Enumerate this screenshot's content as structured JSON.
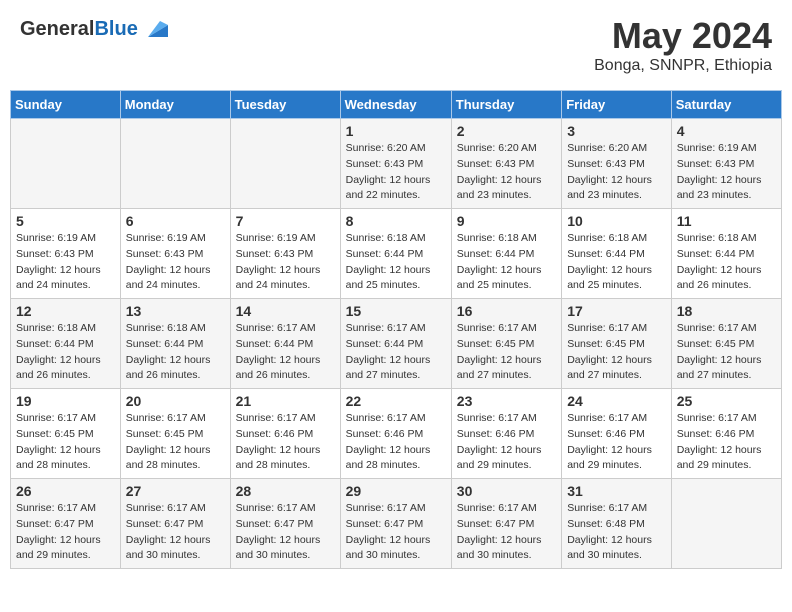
{
  "header": {
    "logo_general": "General",
    "logo_blue": "Blue",
    "main_title": "May 2024",
    "subtitle": "Bonga, SNNPR, Ethiopia"
  },
  "days_of_week": [
    "Sunday",
    "Monday",
    "Tuesday",
    "Wednesday",
    "Thursday",
    "Friday",
    "Saturday"
  ],
  "weeks": [
    {
      "days": [
        {
          "num": "",
          "sunrise": "",
          "sunset": "",
          "daylight": ""
        },
        {
          "num": "",
          "sunrise": "",
          "sunset": "",
          "daylight": ""
        },
        {
          "num": "",
          "sunrise": "",
          "sunset": "",
          "daylight": ""
        },
        {
          "num": "1",
          "sunrise": "Sunrise: 6:20 AM",
          "sunset": "Sunset: 6:43 PM",
          "daylight": "Daylight: 12 hours and 22 minutes."
        },
        {
          "num": "2",
          "sunrise": "Sunrise: 6:20 AM",
          "sunset": "Sunset: 6:43 PM",
          "daylight": "Daylight: 12 hours and 23 minutes."
        },
        {
          "num": "3",
          "sunrise": "Sunrise: 6:20 AM",
          "sunset": "Sunset: 6:43 PM",
          "daylight": "Daylight: 12 hours and 23 minutes."
        },
        {
          "num": "4",
          "sunrise": "Sunrise: 6:19 AM",
          "sunset": "Sunset: 6:43 PM",
          "daylight": "Daylight: 12 hours and 23 minutes."
        }
      ]
    },
    {
      "days": [
        {
          "num": "5",
          "sunrise": "Sunrise: 6:19 AM",
          "sunset": "Sunset: 6:43 PM",
          "daylight": "Daylight: 12 hours and 24 minutes."
        },
        {
          "num": "6",
          "sunrise": "Sunrise: 6:19 AM",
          "sunset": "Sunset: 6:43 PM",
          "daylight": "Daylight: 12 hours and 24 minutes."
        },
        {
          "num": "7",
          "sunrise": "Sunrise: 6:19 AM",
          "sunset": "Sunset: 6:43 PM",
          "daylight": "Daylight: 12 hours and 24 minutes."
        },
        {
          "num": "8",
          "sunrise": "Sunrise: 6:18 AM",
          "sunset": "Sunset: 6:44 PM",
          "daylight": "Daylight: 12 hours and 25 minutes."
        },
        {
          "num": "9",
          "sunrise": "Sunrise: 6:18 AM",
          "sunset": "Sunset: 6:44 PM",
          "daylight": "Daylight: 12 hours and 25 minutes."
        },
        {
          "num": "10",
          "sunrise": "Sunrise: 6:18 AM",
          "sunset": "Sunset: 6:44 PM",
          "daylight": "Daylight: 12 hours and 25 minutes."
        },
        {
          "num": "11",
          "sunrise": "Sunrise: 6:18 AM",
          "sunset": "Sunset: 6:44 PM",
          "daylight": "Daylight: 12 hours and 26 minutes."
        }
      ]
    },
    {
      "days": [
        {
          "num": "12",
          "sunrise": "Sunrise: 6:18 AM",
          "sunset": "Sunset: 6:44 PM",
          "daylight": "Daylight: 12 hours and 26 minutes."
        },
        {
          "num": "13",
          "sunrise": "Sunrise: 6:18 AM",
          "sunset": "Sunset: 6:44 PM",
          "daylight": "Daylight: 12 hours and 26 minutes."
        },
        {
          "num": "14",
          "sunrise": "Sunrise: 6:17 AM",
          "sunset": "Sunset: 6:44 PM",
          "daylight": "Daylight: 12 hours and 26 minutes."
        },
        {
          "num": "15",
          "sunrise": "Sunrise: 6:17 AM",
          "sunset": "Sunset: 6:44 PM",
          "daylight": "Daylight: 12 hours and 27 minutes."
        },
        {
          "num": "16",
          "sunrise": "Sunrise: 6:17 AM",
          "sunset": "Sunset: 6:45 PM",
          "daylight": "Daylight: 12 hours and 27 minutes."
        },
        {
          "num": "17",
          "sunrise": "Sunrise: 6:17 AM",
          "sunset": "Sunset: 6:45 PM",
          "daylight": "Daylight: 12 hours and 27 minutes."
        },
        {
          "num": "18",
          "sunrise": "Sunrise: 6:17 AM",
          "sunset": "Sunset: 6:45 PM",
          "daylight": "Daylight: 12 hours and 27 minutes."
        }
      ]
    },
    {
      "days": [
        {
          "num": "19",
          "sunrise": "Sunrise: 6:17 AM",
          "sunset": "Sunset: 6:45 PM",
          "daylight": "Daylight: 12 hours and 28 minutes."
        },
        {
          "num": "20",
          "sunrise": "Sunrise: 6:17 AM",
          "sunset": "Sunset: 6:45 PM",
          "daylight": "Daylight: 12 hours and 28 minutes."
        },
        {
          "num": "21",
          "sunrise": "Sunrise: 6:17 AM",
          "sunset": "Sunset: 6:46 PM",
          "daylight": "Daylight: 12 hours and 28 minutes."
        },
        {
          "num": "22",
          "sunrise": "Sunrise: 6:17 AM",
          "sunset": "Sunset: 6:46 PM",
          "daylight": "Daylight: 12 hours and 28 minutes."
        },
        {
          "num": "23",
          "sunrise": "Sunrise: 6:17 AM",
          "sunset": "Sunset: 6:46 PM",
          "daylight": "Daylight: 12 hours and 29 minutes."
        },
        {
          "num": "24",
          "sunrise": "Sunrise: 6:17 AM",
          "sunset": "Sunset: 6:46 PM",
          "daylight": "Daylight: 12 hours and 29 minutes."
        },
        {
          "num": "25",
          "sunrise": "Sunrise: 6:17 AM",
          "sunset": "Sunset: 6:46 PM",
          "daylight": "Daylight: 12 hours and 29 minutes."
        }
      ]
    },
    {
      "days": [
        {
          "num": "26",
          "sunrise": "Sunrise: 6:17 AM",
          "sunset": "Sunset: 6:47 PM",
          "daylight": "Daylight: 12 hours and 29 minutes."
        },
        {
          "num": "27",
          "sunrise": "Sunrise: 6:17 AM",
          "sunset": "Sunset: 6:47 PM",
          "daylight": "Daylight: 12 hours and 30 minutes."
        },
        {
          "num": "28",
          "sunrise": "Sunrise: 6:17 AM",
          "sunset": "Sunset: 6:47 PM",
          "daylight": "Daylight: 12 hours and 30 minutes."
        },
        {
          "num": "29",
          "sunrise": "Sunrise: 6:17 AM",
          "sunset": "Sunset: 6:47 PM",
          "daylight": "Daylight: 12 hours and 30 minutes."
        },
        {
          "num": "30",
          "sunrise": "Sunrise: 6:17 AM",
          "sunset": "Sunset: 6:47 PM",
          "daylight": "Daylight: 12 hours and 30 minutes."
        },
        {
          "num": "31",
          "sunrise": "Sunrise: 6:17 AM",
          "sunset": "Sunset: 6:48 PM",
          "daylight": "Daylight: 12 hours and 30 minutes."
        },
        {
          "num": "",
          "sunrise": "",
          "sunset": "",
          "daylight": ""
        }
      ]
    }
  ]
}
